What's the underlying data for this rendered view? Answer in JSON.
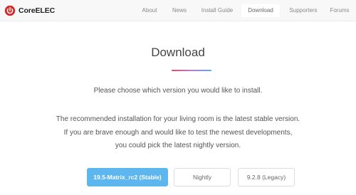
{
  "brand": {
    "name": "CoreELEC",
    "icon": "power-icon",
    "color": "#d32a2a"
  },
  "nav": {
    "items": [
      {
        "label": "About",
        "active": false
      },
      {
        "label": "News",
        "active": false
      },
      {
        "label": "Install Guide",
        "active": false
      },
      {
        "label": "Download",
        "active": true
      },
      {
        "label": "Supporters",
        "active": false
      },
      {
        "label": "Forums",
        "active": false
      }
    ]
  },
  "main": {
    "title": "Download",
    "intro": "Please choose which version you would like to install.",
    "recommendation": [
      "The recommended installation for your living room is the latest stable version.",
      "If you are brave enough and would like to test the newest developments,",
      "you could pick the latest nightly version."
    ],
    "buttons": {
      "stable": "19.5-Matrix_rc2 (Stable)",
      "nightly": "Nightly",
      "legacy": "9.2.8 (Legacy)"
    }
  },
  "colors": {
    "accent": "#5db6ee",
    "rule_start": "#e6476b",
    "rule_end": "#5aa9e6"
  }
}
